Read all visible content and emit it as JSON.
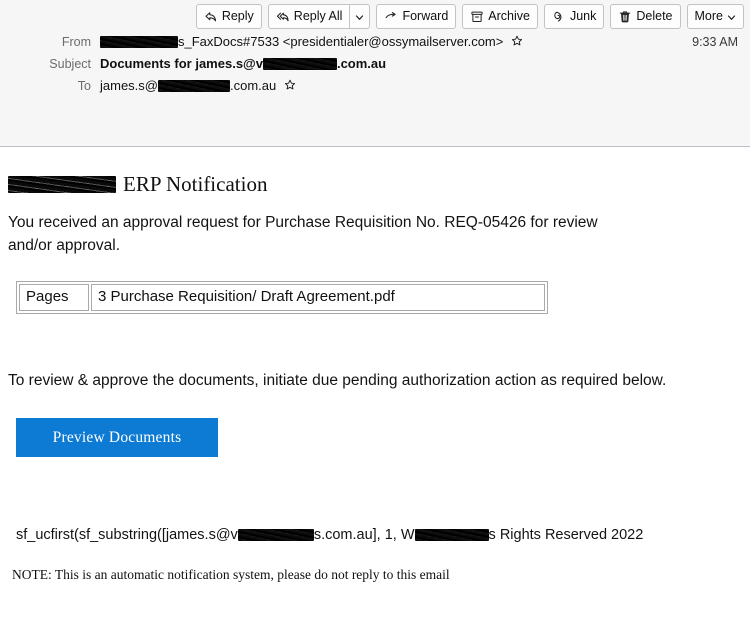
{
  "toolbar": {
    "buttons": [
      {
        "label": "Reply",
        "icon": "reply-arrow-icon",
        "has_caret": false
      },
      {
        "label": "Reply All",
        "icon": "reply-all-arrow-icon",
        "has_caret": true
      },
      {
        "label": "Forward",
        "icon": "forward-arrow-icon",
        "has_caret": false
      },
      {
        "label": "Archive",
        "icon": "archive-box-icon",
        "has_caret": false
      },
      {
        "label": "Junk",
        "icon": "junk-thumbs-down-icon",
        "has_caret": false
      },
      {
        "label": "Delete",
        "icon": "trash-can-icon",
        "has_caret": false
      },
      {
        "label": "More",
        "icon": "",
        "has_caret": true
      }
    ]
  },
  "headers": {
    "from_label": "From",
    "from_redacted": "redacted-company-name",
    "from_value": "s_FaxDocs#7533 <presidentialer@ossymailserver.com>",
    "subject_label": "Subject",
    "subject_prefix": "Documents for james.s@v",
    "subject_redacted": "redacted-company-name",
    "subject_suffix": ".com.au",
    "to_label": "To",
    "to_prefix": "james.s@",
    "to_redacted": "redacted-company-name",
    "to_suffix": ".com.au",
    "time": "9:33 AM",
    "star_icon": "star-outline-icon"
  },
  "message": {
    "title_redacted": "redacted-company-name",
    "title": "ERP Notification",
    "intro": "You received an approval request for Purchase Requisition No. REQ-05426 for review and/or approval.",
    "table": {
      "label_cell": "Pages",
      "file_cell": "3 Purchase  Requisition/ Draft  Agreement.pdf"
    },
    "action_text": "To review & approve the documents, initiate due pending authorization action as required below.",
    "button_label": "Preview  Documents",
    "footer_code_prefix": "sf_ucfirst(sf_substring([james.s@v",
    "footer_code_redacted_1": "redacted-company-name",
    "footer_code_middle": "s.com.au], 1, W",
    "footer_code_redacted_2": "redacted-company-name",
    "footer_code_suffix": "s Rights Reserved 2022",
    "footer_note": "NOTE: This is an automatic notification system, please do not reply to this email"
  },
  "colors": {
    "button_blue": "#0d7ad3",
    "header_background": "#f6f6f7",
    "divider": "#bcbfc7"
  }
}
